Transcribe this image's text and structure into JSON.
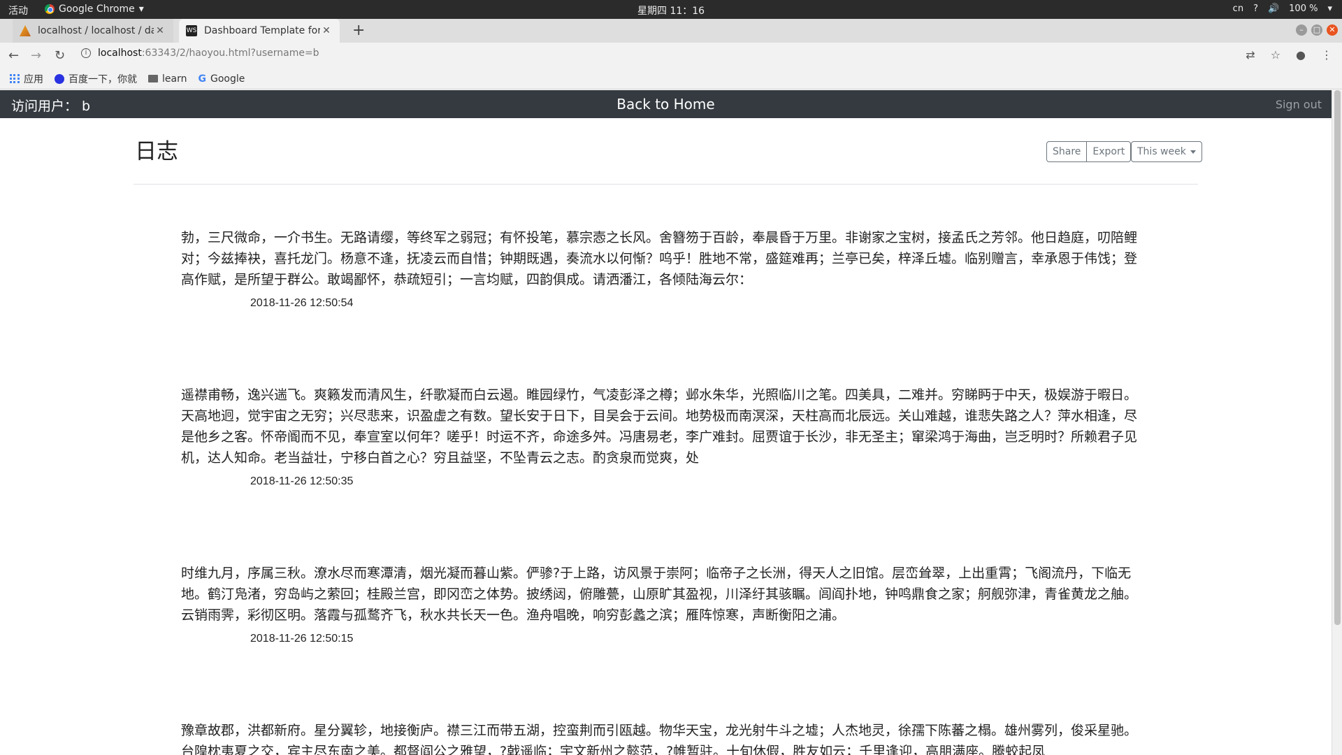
{
  "os": {
    "activities": "活动",
    "app_name": "Google Chrome",
    "clock": "星期四 11：16",
    "tray": [
      "cn",
      "?",
      "100 %"
    ]
  },
  "browser": {
    "tabs": [
      {
        "title": "localhost / localhost / dat",
        "active": false
      },
      {
        "title": "Dashboard Template for B",
        "active": true
      }
    ],
    "url_host": "localhost",
    "url_path": ":63343/2/haoyou.html?username=b",
    "bookmarks": [
      "应用",
      "百度一下，你就",
      "learn",
      "Google"
    ]
  },
  "navbar": {
    "user_label": "访问用户： b",
    "home_link": "Back to Home",
    "signout": "Sign out"
  },
  "main": {
    "title": "日志",
    "share_label": "Share",
    "export_label": "Export",
    "range_label": "This week"
  },
  "entries": [
    {
      "text": "勃，三尺微命，一介书生。无路请缨，等终军之弱冠；有怀投笔，慕宗悫之长风。舍簪笏于百龄，奉晨昏于万里。非谢家之宝树，接孟氏之芳邻。他日趋庭，叨陪鲤对；今兹捧袂，喜托龙门。杨意不逢，抚凌云而自惜；钟期既遇，奏流水以何惭？呜乎！胜地不常，盛筵难再；兰亭已矣，梓泽丘墟。临别赠言，幸承恩于伟饯；登高作赋，是所望于群公。敢竭鄙怀，恭疏短引；一言均赋，四韵俱成。请洒潘江，各倾陆海云尔：",
      "date": "2018-11-26 12:50:54"
    },
    {
      "text": "遥襟甫畅，逸兴遄飞。爽籁发而清风生，纤歌凝而白云遏。睢园绿竹，气凌彭泽之樽；邺水朱华，光照临川之笔。四美具，二难并。穷睇眄于中天，极娱游于暇日。天高地迥，觉宇宙之无穷；兴尽悲来，识盈虚之有数。望长安于日下，目吴会于云间。地势极而南溟深，天柱高而北辰远。关山难越，谁悲失路之人？萍水相逢，尽是他乡之客。怀帝阍而不见，奉宣室以何年？嗟乎！时运不齐，命途多舛。冯唐易老，李广难封。屈贾谊于长沙，非无圣主；窜梁鸿于海曲，岂乏明时？所赖君子见机，达人知命。老当益壮，宁移白首之心？穷且益坚，不坠青云之志。酌贪泉而觉爽，处",
      "date": "2018-11-26 12:50:35"
    },
    {
      "text": "时维九月，序属三秋。潦水尽而寒潭清，烟光凝而暮山紫。俨骖?于上路，访风景于崇阿；临帝子之长洲，得天人之旧馆。层峦耸翠，上出重霄；飞阁流丹，下临无地。鹤汀凫渚，穷岛屿之萦回；桂殿兰宫，即冈峦之体势。披绣闼，俯雕甍，山原旷其盈视，川泽纡其骇瞩。闾阎扑地，钟鸣鼎食之家；舸舰弥津，青雀黄龙之舳。云销雨霁，彩彻区明。落霞与孤鹜齐飞，秋水共长天一色。渔舟唱晚，响穷彭蠡之滨；雁阵惊寒，声断衡阳之浦。",
      "date": "2018-11-26 12:50:15"
    },
    {
      "text": "豫章故郡，洪都新府。星分翼轸，地接衡庐。襟三江而带五湖，控蛮荆而引瓯越。物华天宝，龙光射牛斗之墟；人杰地灵，徐孺下陈蕃之榻。雄州雾列，俊采星驰。台隍枕夷夏之交，宾主尽东南之美。都督阎公之雅望，?戟遥临；宇文新州之懿范，?帷暂驻。十旬休假，胜友如云；千里逢迎，高朋满座。腾蛟起凤",
      "date": ""
    }
  ]
}
